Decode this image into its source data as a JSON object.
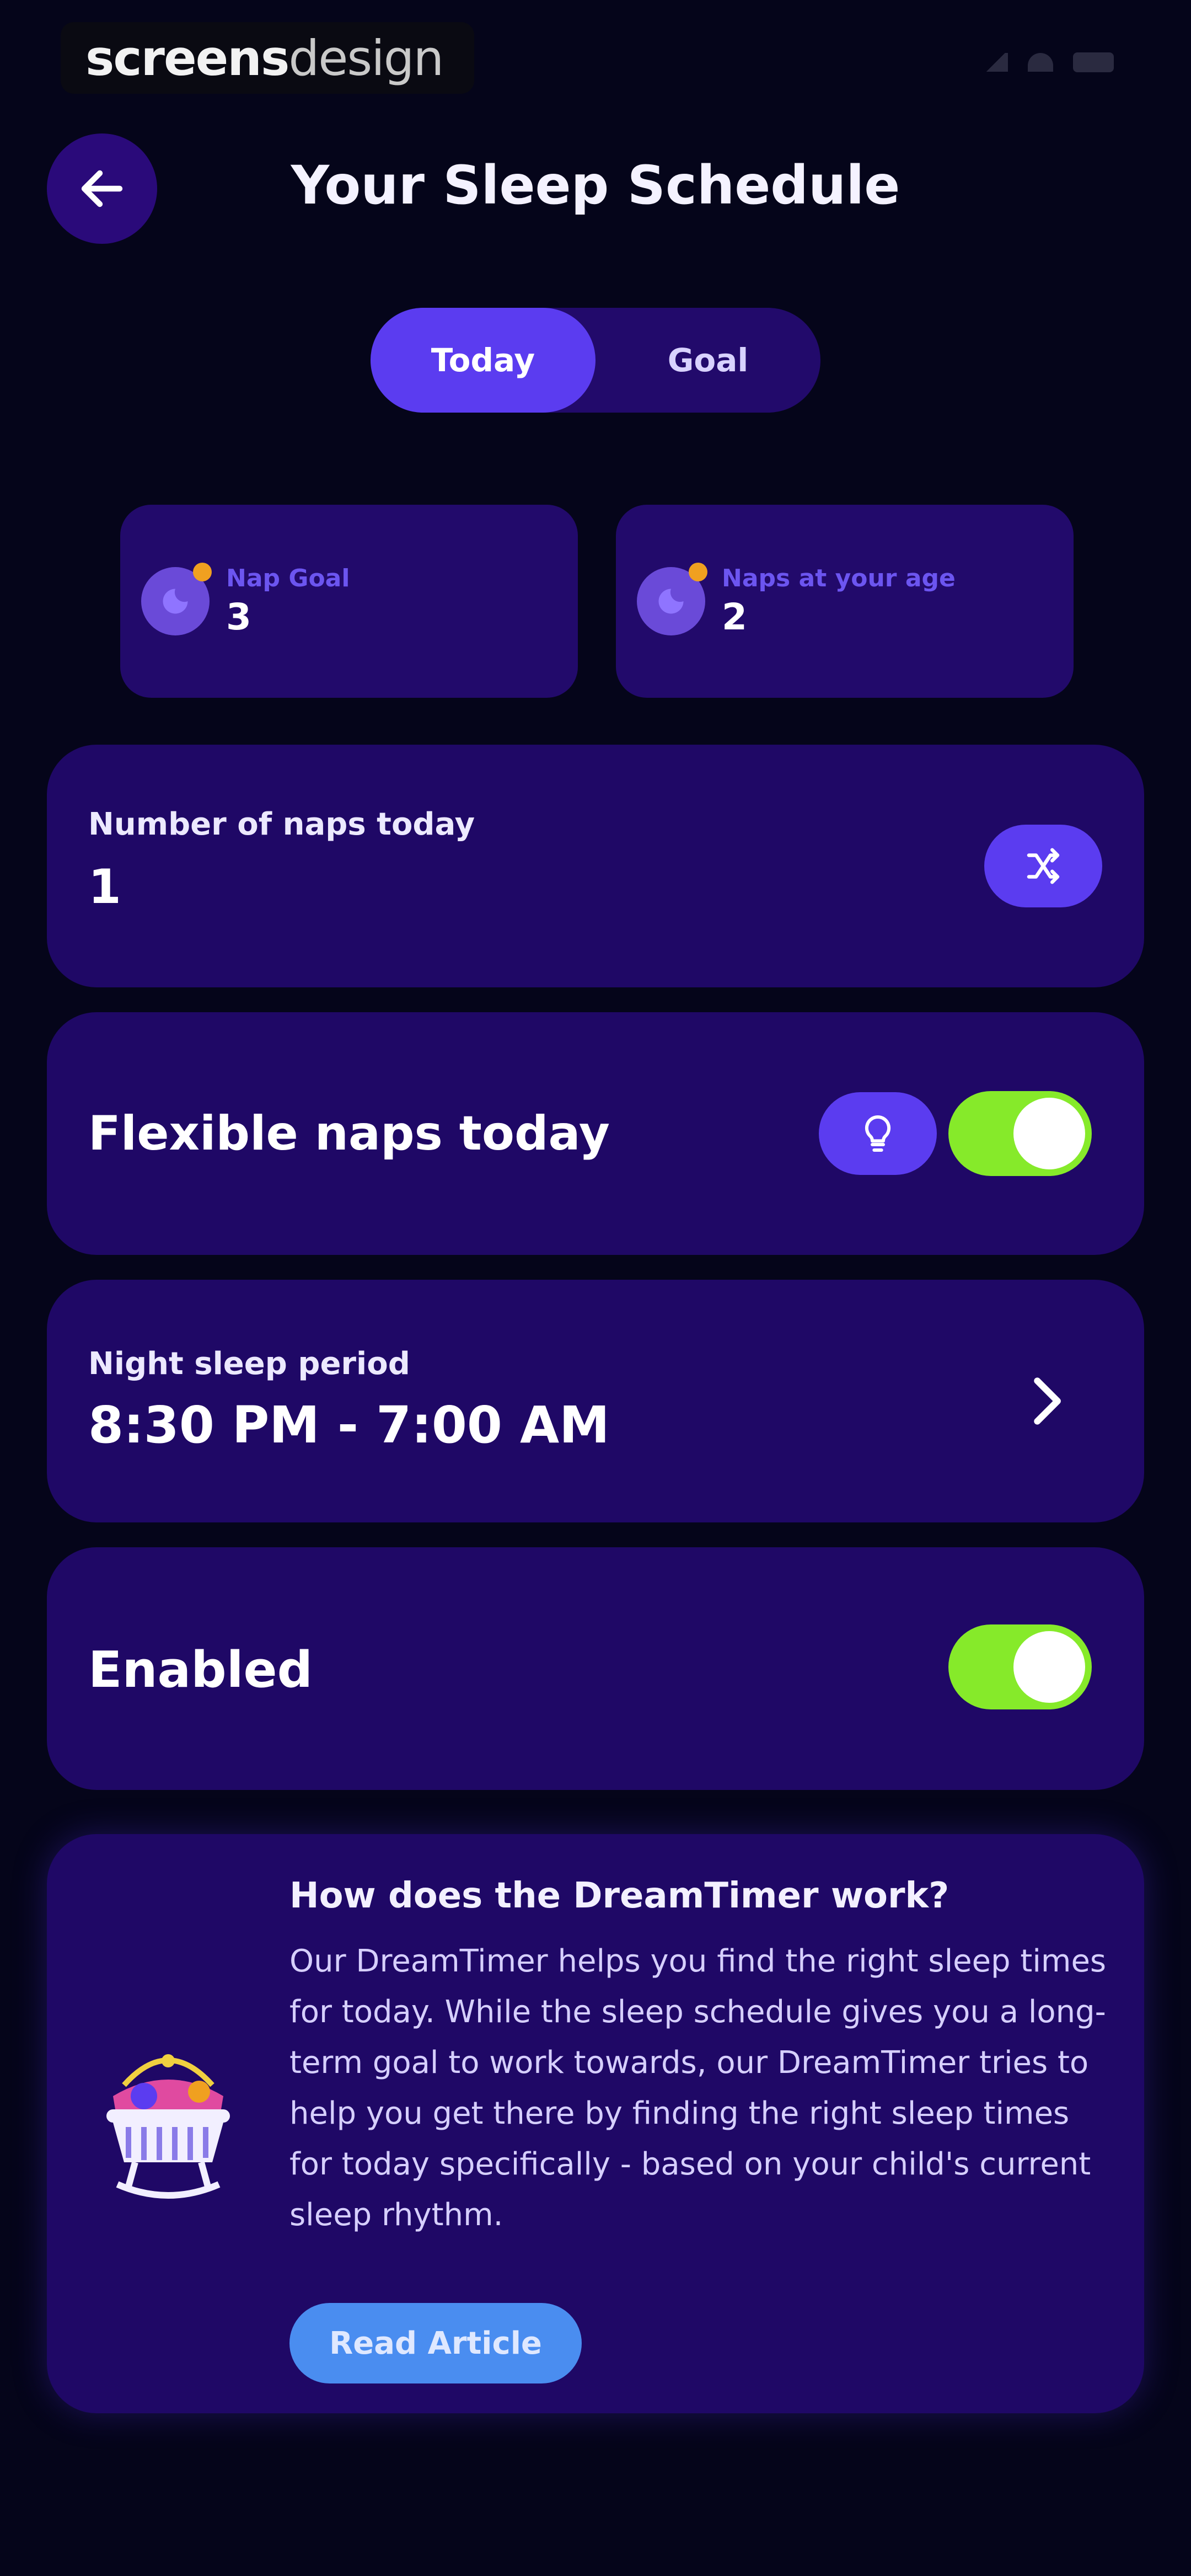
{
  "watermark": {
    "part1": "screens",
    "part2": "design"
  },
  "header": {
    "title": "Your Sleep Schedule"
  },
  "tabs": [
    {
      "label": "Today",
      "active": true
    },
    {
      "label": "Goal",
      "active": false
    }
  ],
  "stats": [
    {
      "label": "Nap Goal",
      "value": "3",
      "icon": "moon-badge-icon"
    },
    {
      "label": "Naps at your age",
      "value": "2",
      "icon": "moon-badge-icon"
    }
  ],
  "naps_today": {
    "label": "Number of naps today",
    "value": "1",
    "icon": "shuffle-icon"
  },
  "flexible": {
    "label": "Flexible naps today",
    "icon": "lightbulb-icon",
    "enabled": true
  },
  "night_sleep": {
    "label": "Night sleep period",
    "value": "8:30 PM - 7:00 AM",
    "icon": "chevron-right-icon"
  },
  "enabled_row": {
    "label": "Enabled",
    "enabled": true
  },
  "info": {
    "title": "How does the DreamTimer work?",
    "body": "Our DreamTimer helps you find the right sleep times for today. While the sleep schedule gives you a long-term goal to work towards, our DreamTimer tries to help you get there by finding the right sleep times for today specifically - based on your child's current sleep rhythm.",
    "button": "Read Article",
    "illustration": "cradle-illustration"
  },
  "colors": {
    "background": "#05051a",
    "card": "#1f0866",
    "accent": "#5b3cf0",
    "toggle_on": "#86ea2a",
    "link_button": "#4a8df0"
  }
}
